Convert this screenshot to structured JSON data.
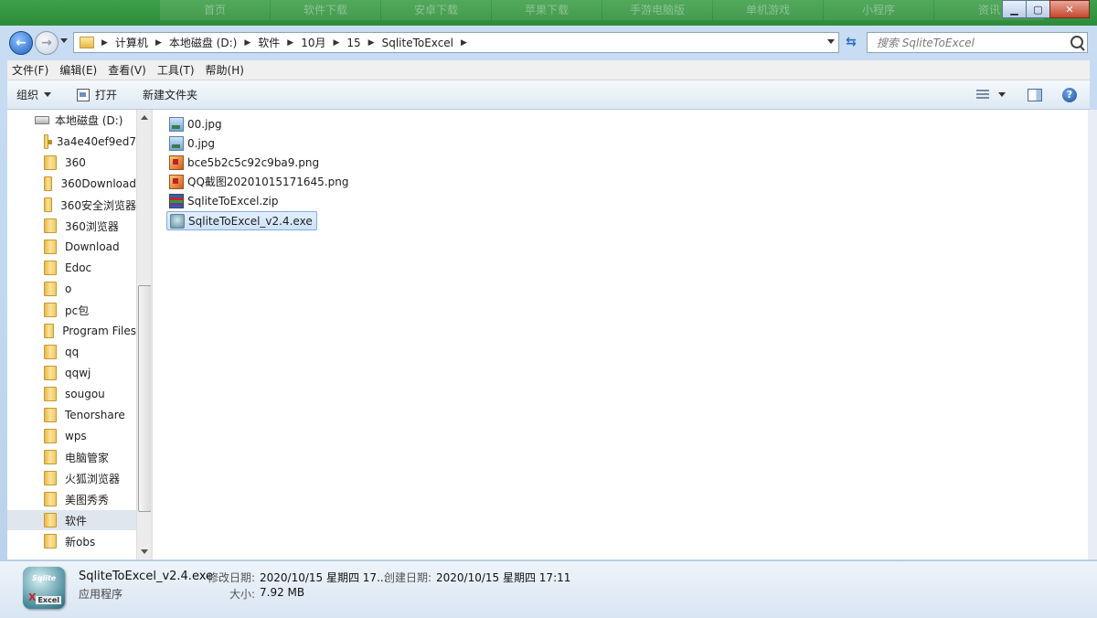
{
  "background_tabs": [
    "首页",
    "软件下载",
    "安卓下载",
    "苹果下载",
    "手游电脑版",
    "单机游戏",
    "小程序",
    "资讯"
  ],
  "window_controls": {
    "minimize": "▁",
    "maximize": "▢",
    "close": "✕"
  },
  "address": {
    "breadcrumbs": [
      "计算机",
      "本地磁盘 (D:)",
      "软件",
      "10月",
      "15",
      "SqliteToExcel"
    ],
    "search_placeholder": "搜索 SqliteToExcel"
  },
  "menu": [
    "文件(F)",
    "编辑(E)",
    "查看(V)",
    "工具(T)",
    "帮助(H)"
  ],
  "toolbar": {
    "organize": "组织",
    "open": "打开",
    "new_folder": "新建文件夹",
    "help": "?"
  },
  "nav_tree": {
    "drive": "本地磁盘 (D:)",
    "items": [
      {
        "label": "3a4e40ef9ed7",
        "lock": true
      },
      {
        "label": "360"
      },
      {
        "label": "360Download"
      },
      {
        "label": "360安全浏览器"
      },
      {
        "label": "360浏览器"
      },
      {
        "label": "Download"
      },
      {
        "label": "Edoc"
      },
      {
        "label": "o"
      },
      {
        "label": "pc包"
      },
      {
        "label": "Program Files"
      },
      {
        "label": "qq"
      },
      {
        "label": "qqwj"
      },
      {
        "label": "sougou"
      },
      {
        "label": "Tenorshare"
      },
      {
        "label": "wps"
      },
      {
        "label": "电脑管家"
      },
      {
        "label": "火狐浏览器"
      },
      {
        "label": "美图秀秀"
      },
      {
        "label": "软件",
        "selected": true
      },
      {
        "label": "新obs"
      }
    ]
  },
  "files": [
    {
      "name": "00.jpg",
      "icon": "jpg-image-icon"
    },
    {
      "name": "0.jpg",
      "icon": "jpg-image-icon"
    },
    {
      "name": "bce5b2c5c92c9ba9.png",
      "icon": "png-image-icon"
    },
    {
      "name": "QQ截图20201015171645.png",
      "icon": "png-image-icon"
    },
    {
      "name": "SqliteToExcel.zip",
      "icon": "zip-archive-icon"
    },
    {
      "name": "SqliteToExcel_v2.4.exe",
      "icon": "exe-app-icon",
      "selected": true
    }
  ],
  "details": {
    "name": "SqliteToExcel_v2.4.exe",
    "type": "应用程序",
    "modified_label": "修改日期:",
    "modified_value": "2020/10/15 星期四 17...",
    "created_label": "创建日期:",
    "created_value": "2020/10/15 星期四 17:11",
    "size_label": "大小:",
    "size_value": "7.92 MB",
    "icon_text_top": "Sqlite",
    "icon_text_bottom": "Excel"
  }
}
